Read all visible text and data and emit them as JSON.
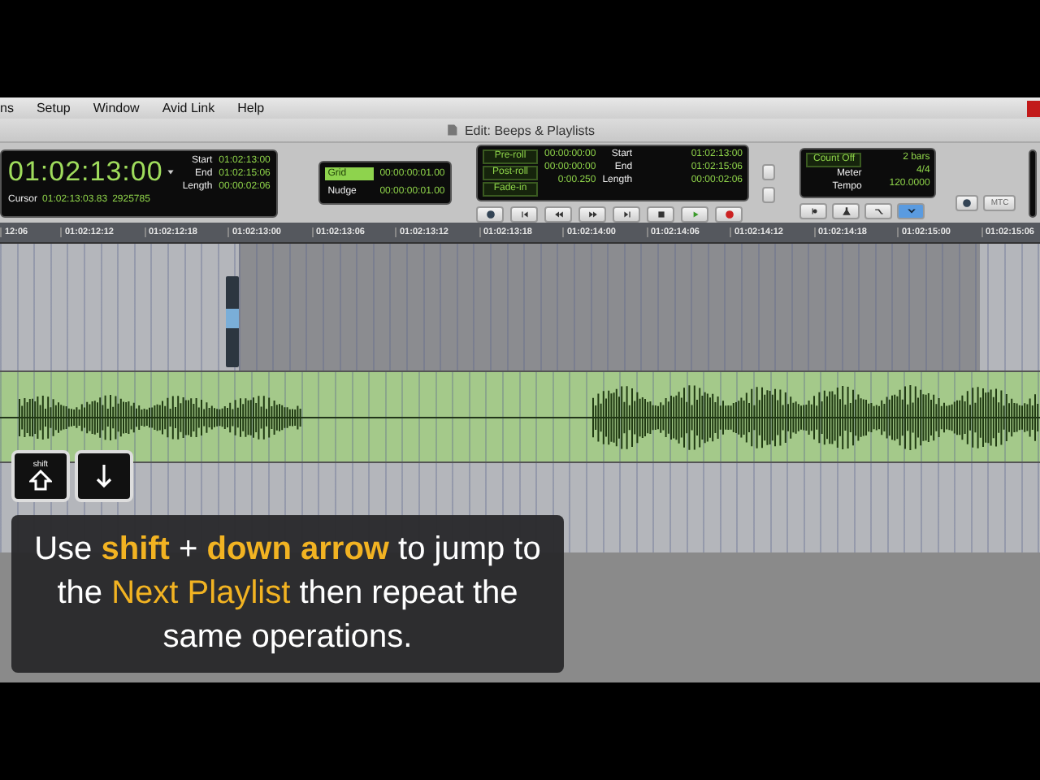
{
  "menu_bar": {
    "items": [
      "ns",
      "Setup",
      "Window",
      "Avid Link",
      "Help"
    ]
  },
  "window": {
    "title": "Edit: Beeps & Playlists"
  },
  "counter": {
    "main": "01:02:13:00",
    "fields": [
      {
        "label": "Start",
        "value": "01:02:13:00"
      },
      {
        "label": "End",
        "value": "01:02:15:06"
      },
      {
        "label": "Length",
        "value": "00:00:02:06"
      }
    ],
    "cursor_label": "Cursor",
    "cursor_value": "01:02:13:03.83",
    "sample": "2925785"
  },
  "grid_nudge": [
    {
      "label": "Grid",
      "value": "00:00:00:01.00",
      "selected": true
    },
    {
      "label": "Nudge",
      "value": "00:00:00:01.00",
      "selected": false
    }
  ],
  "transport": {
    "rolls": [
      {
        "label": "Pre-roll",
        "value": "00:00:00:00"
      },
      {
        "label": "Post-roll",
        "value": "00:00:00:00"
      },
      {
        "label": "Fade-in",
        "value": "0:00.250"
      }
    ],
    "fields": [
      {
        "label": "Start",
        "value": "01:02:13:00"
      },
      {
        "label": "End",
        "value": "01:02:15:06"
      },
      {
        "label": "Length",
        "value": "00:00:02:06"
      }
    ]
  },
  "tempo": {
    "count_off": "Count Off",
    "count_value": "2 bars",
    "meter_label": "Meter",
    "meter": "4/4",
    "tempo_label": "Tempo",
    "tempo": "120.0000"
  },
  "mtc_button": "MTC",
  "ruler": [
    "12:06",
    "01:02:12:12",
    "01:02:12:18",
    "01:02:13:00",
    "01:02:13:06",
    "01:02:13:12",
    "01:02:13:18",
    "01:02:14:00",
    "01:02:14:06",
    "01:02:14:12",
    "01:02:14:18",
    "01:02:15:00",
    "01:02:15:06"
  ],
  "caption": {
    "keys": [
      {
        "kind": "shift",
        "label": "shift"
      },
      {
        "kind": "down"
      }
    ],
    "text": "Use **shift** + **down arrow** to jump to the *Next Playlist* then repeat the same operations."
  }
}
